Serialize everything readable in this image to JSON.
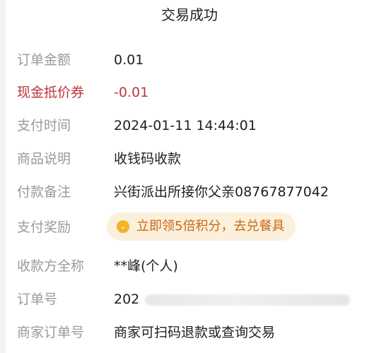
{
  "header": {
    "title": "交易成功"
  },
  "details": {
    "order_amount": {
      "label": "订单金额",
      "value": "0.01"
    },
    "cash_coupon": {
      "label": "现金抵价券",
      "value": "-0.01"
    },
    "pay_time": {
      "label": "支付时间",
      "value": "2024-01-11 14:44:01"
    },
    "product_desc": {
      "label": "商品说明",
      "value": "收钱码收款"
    },
    "payment_note": {
      "label": "付款备注",
      "value": "兴街派出所接你父亲08767877042"
    },
    "pay_reward": {
      "label": "支付奖励",
      "pill_text": "立即领5倍积分，去兑餐具",
      "icon": "chevron-down-icon"
    },
    "payee_name": {
      "label": "收款方全称",
      "value": "**峰(个人)"
    },
    "order_no": {
      "label": "订单号",
      "visible_prefix": "202"
    },
    "merchant_order": {
      "label": "商家订单号",
      "value": "商家可扫码退款或查询交易"
    }
  },
  "colors": {
    "label_gray": "#9a9a9a",
    "coupon_red": "#c0343b",
    "reward_bg": "#fbf0dc",
    "reward_text": "#c96a12",
    "reward_icon": "#f0b429"
  }
}
